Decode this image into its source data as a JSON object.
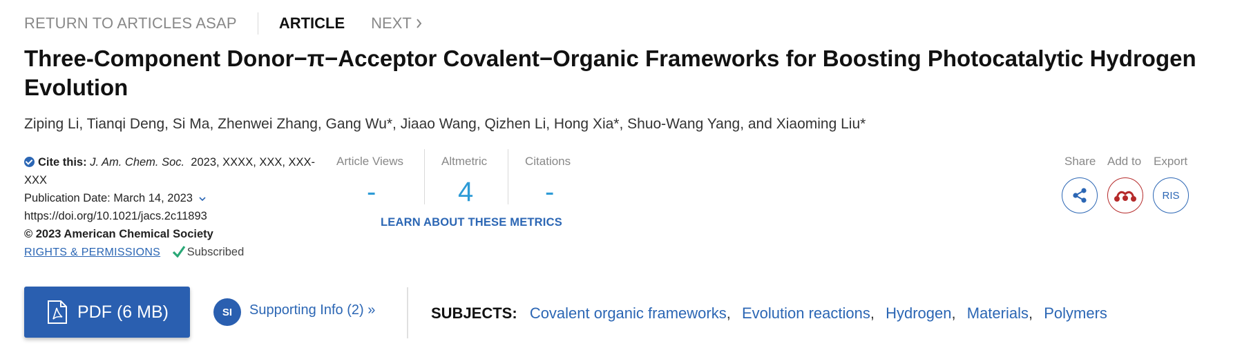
{
  "nav": {
    "return_label": "RETURN TO ARTICLES ASAP",
    "article_label": "ARTICLE",
    "next_label": "NEXT"
  },
  "article": {
    "title": "Three-Component Donor−π−Acceptor Covalent−Organic Frameworks for Boosting Photocatalytic Hydrogen Evolution",
    "authors": "Ziping Li, Tianqi Deng, Si Ma, Zhenwei Zhang, Gang Wu*, Jiaao Wang, Qizhen Li, Hong Xia*, Shuo-Wang Yang, and Xiaoming Liu*"
  },
  "citation": {
    "cite_label": "Cite this:",
    "journal": "J. Am. Chem. Soc.",
    "details": "2023, XXXX, XXX, XXX-",
    "details_cont": "XXX",
    "pub_date": "Publication Date: March 14, 2023",
    "doi": "https://doi.org/10.1021/jacs.2c11893",
    "copyright": "© 2023 American Chemical Society",
    "rights_link": "RIGHTS & PERMISSIONS",
    "subscribed": "Subscribed"
  },
  "metrics": {
    "views_label": "Article Views",
    "views_value": "-",
    "altmetric_label": "Altmetric",
    "altmetric_value": "4",
    "citations_label": "Citations",
    "citations_value": "-",
    "learn_link": "LEARN ABOUT THESE METRICS"
  },
  "actions": {
    "share_label": "Share",
    "add_label": "Add to",
    "export_label": "Export",
    "export_button": "RIS"
  },
  "bottom": {
    "pdf_label": "PDF (6 MB)",
    "si_badge": "SI",
    "si_label": "Supporting Info (2) »",
    "subjects_label": "SUBJECTS:",
    "subjects": [
      "Covalent organic frameworks",
      "Evolution reactions",
      "Hydrogen",
      "Materials",
      "Polymers"
    ]
  },
  "colors": {
    "link_blue": "#2b66b4",
    "metric_blue": "#2d9bd6",
    "button_blue": "#2a5fb0",
    "check_green": "#2aa877",
    "mendeley_red": "#b52a2a"
  }
}
